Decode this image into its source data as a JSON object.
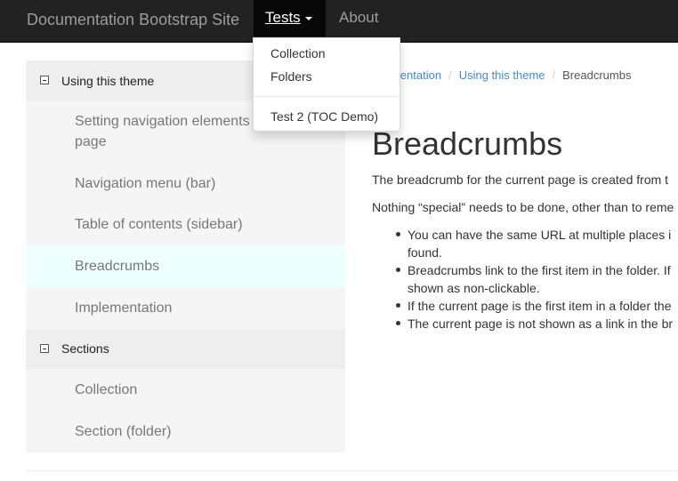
{
  "navbar": {
    "brand": "Documentation Bootstrap Site",
    "tests_label": "Tests",
    "about_label": "About"
  },
  "dropdown": {
    "items": [
      "Collection",
      "Folders"
    ],
    "extra": "Test 2 (TOC Demo)"
  },
  "sidebar": {
    "section1": {
      "label": "Using this theme",
      "items": [
        "Setting navigation elements page",
        "Navigation menu (bar)",
        "Table of contents (sidebar)",
        "Breadcrumbs",
        "Implementation"
      ],
      "active_item": "Breadcrumbs"
    },
    "section2": {
      "label": "Sections",
      "items": [
        "Collection",
        "Section (folder)"
      ]
    }
  },
  "breadcrumb": {
    "link1": "ocumentation",
    "link2": "Using this theme",
    "current": "Breadcrumbs",
    "separator": "/"
  },
  "main": {
    "title": "Breadcrumbs",
    "para1": "The breadcrumb for the current page is created from t",
    "para2": "Nothing “special” needs to be done, other than to reme",
    "bullets": [
      "You can have the same URL at multiple places i\nfound.",
      "Breadcrumbs link to the first item in the folder. If\nshown as non-clickable.",
      "If the current page is the first item in a folder the",
      "The current page is not shown as a link in the br"
    ]
  }
}
